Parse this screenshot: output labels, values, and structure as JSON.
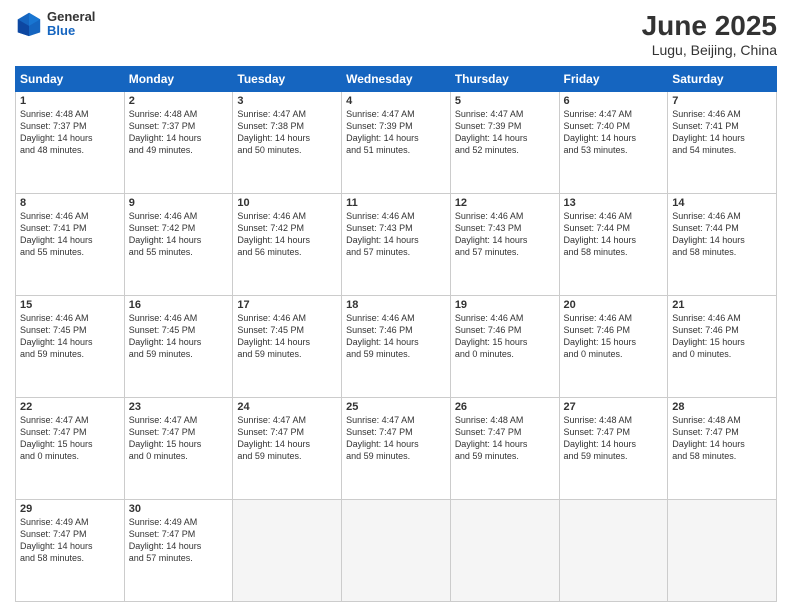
{
  "logo": {
    "general": "General",
    "blue": "Blue"
  },
  "header": {
    "title": "June 2025",
    "subtitle": "Lugu, Beijing, China"
  },
  "weekdays": [
    "Sunday",
    "Monday",
    "Tuesday",
    "Wednesday",
    "Thursday",
    "Friday",
    "Saturday"
  ],
  "weeks": [
    [
      {
        "day": "1",
        "info": "Sunrise: 4:48 AM\nSunset: 7:37 PM\nDaylight: 14 hours\nand 48 minutes."
      },
      {
        "day": "2",
        "info": "Sunrise: 4:48 AM\nSunset: 7:37 PM\nDaylight: 14 hours\nand 49 minutes."
      },
      {
        "day": "3",
        "info": "Sunrise: 4:47 AM\nSunset: 7:38 PM\nDaylight: 14 hours\nand 50 minutes."
      },
      {
        "day": "4",
        "info": "Sunrise: 4:47 AM\nSunset: 7:39 PM\nDaylight: 14 hours\nand 51 minutes."
      },
      {
        "day": "5",
        "info": "Sunrise: 4:47 AM\nSunset: 7:39 PM\nDaylight: 14 hours\nand 52 minutes."
      },
      {
        "day": "6",
        "info": "Sunrise: 4:47 AM\nSunset: 7:40 PM\nDaylight: 14 hours\nand 53 minutes."
      },
      {
        "day": "7",
        "info": "Sunrise: 4:46 AM\nSunset: 7:41 PM\nDaylight: 14 hours\nand 54 minutes."
      }
    ],
    [
      {
        "day": "8",
        "info": "Sunrise: 4:46 AM\nSunset: 7:41 PM\nDaylight: 14 hours\nand 55 minutes."
      },
      {
        "day": "9",
        "info": "Sunrise: 4:46 AM\nSunset: 7:42 PM\nDaylight: 14 hours\nand 55 minutes."
      },
      {
        "day": "10",
        "info": "Sunrise: 4:46 AM\nSunset: 7:42 PM\nDaylight: 14 hours\nand 56 minutes."
      },
      {
        "day": "11",
        "info": "Sunrise: 4:46 AM\nSunset: 7:43 PM\nDaylight: 14 hours\nand 57 minutes."
      },
      {
        "day": "12",
        "info": "Sunrise: 4:46 AM\nSunset: 7:43 PM\nDaylight: 14 hours\nand 57 minutes."
      },
      {
        "day": "13",
        "info": "Sunrise: 4:46 AM\nSunset: 7:44 PM\nDaylight: 14 hours\nand 58 minutes."
      },
      {
        "day": "14",
        "info": "Sunrise: 4:46 AM\nSunset: 7:44 PM\nDaylight: 14 hours\nand 58 minutes."
      }
    ],
    [
      {
        "day": "15",
        "info": "Sunrise: 4:46 AM\nSunset: 7:45 PM\nDaylight: 14 hours\nand 59 minutes."
      },
      {
        "day": "16",
        "info": "Sunrise: 4:46 AM\nSunset: 7:45 PM\nDaylight: 14 hours\nand 59 minutes."
      },
      {
        "day": "17",
        "info": "Sunrise: 4:46 AM\nSunset: 7:45 PM\nDaylight: 14 hours\nand 59 minutes."
      },
      {
        "day": "18",
        "info": "Sunrise: 4:46 AM\nSunset: 7:46 PM\nDaylight: 14 hours\nand 59 minutes."
      },
      {
        "day": "19",
        "info": "Sunrise: 4:46 AM\nSunset: 7:46 PM\nDaylight: 15 hours\nand 0 minutes."
      },
      {
        "day": "20",
        "info": "Sunrise: 4:46 AM\nSunset: 7:46 PM\nDaylight: 15 hours\nand 0 minutes."
      },
      {
        "day": "21",
        "info": "Sunrise: 4:46 AM\nSunset: 7:46 PM\nDaylight: 15 hours\nand 0 minutes."
      }
    ],
    [
      {
        "day": "22",
        "info": "Sunrise: 4:47 AM\nSunset: 7:47 PM\nDaylight: 15 hours\nand 0 minutes."
      },
      {
        "day": "23",
        "info": "Sunrise: 4:47 AM\nSunset: 7:47 PM\nDaylight: 15 hours\nand 0 minutes."
      },
      {
        "day": "24",
        "info": "Sunrise: 4:47 AM\nSunset: 7:47 PM\nDaylight: 14 hours\nand 59 minutes."
      },
      {
        "day": "25",
        "info": "Sunrise: 4:47 AM\nSunset: 7:47 PM\nDaylight: 14 hours\nand 59 minutes."
      },
      {
        "day": "26",
        "info": "Sunrise: 4:48 AM\nSunset: 7:47 PM\nDaylight: 14 hours\nand 59 minutes."
      },
      {
        "day": "27",
        "info": "Sunrise: 4:48 AM\nSunset: 7:47 PM\nDaylight: 14 hours\nand 59 minutes."
      },
      {
        "day": "28",
        "info": "Sunrise: 4:48 AM\nSunset: 7:47 PM\nDaylight: 14 hours\nand 58 minutes."
      }
    ],
    [
      {
        "day": "29",
        "info": "Sunrise: 4:49 AM\nSunset: 7:47 PM\nDaylight: 14 hours\nand 58 minutes."
      },
      {
        "day": "30",
        "info": "Sunrise: 4:49 AM\nSunset: 7:47 PM\nDaylight: 14 hours\nand 57 minutes."
      },
      {
        "day": "",
        "info": ""
      },
      {
        "day": "",
        "info": ""
      },
      {
        "day": "",
        "info": ""
      },
      {
        "day": "",
        "info": ""
      },
      {
        "day": "",
        "info": ""
      }
    ]
  ]
}
